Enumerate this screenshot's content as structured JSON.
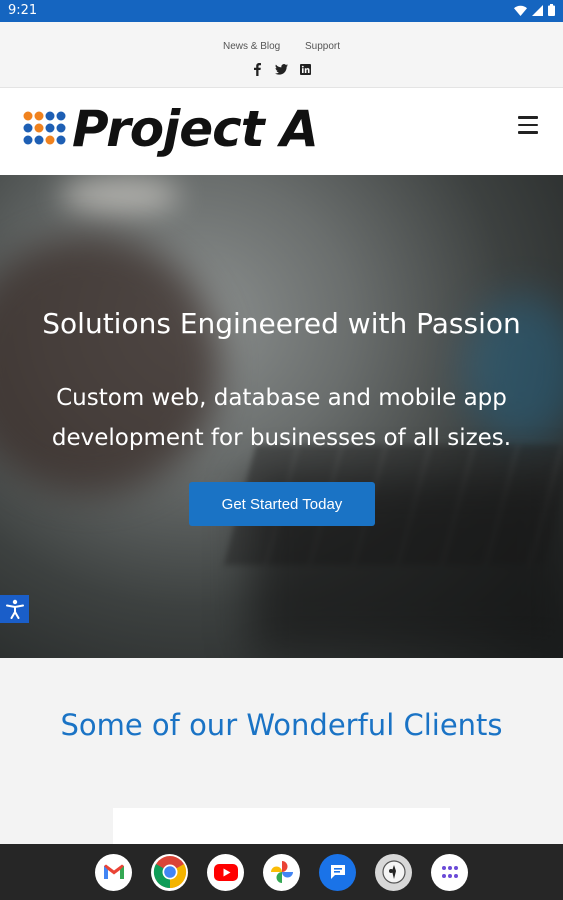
{
  "status": {
    "time": "9:21"
  },
  "topbar": {
    "links": [
      "News & Blog",
      "Support"
    ],
    "social": [
      "facebook-icon",
      "twitter-icon",
      "linkedin-icon"
    ]
  },
  "header": {
    "logo_text": "Project A"
  },
  "hero": {
    "headline": "Solutions Engineered with Passion",
    "subhead": "Custom web, database and mobile app development for businesses of all sizes.",
    "cta": "Get Started Today"
  },
  "clients": {
    "title": "Some of our Wonderful Clients"
  },
  "taskbar": {
    "apps": [
      "gmail-icon",
      "chrome-icon",
      "youtube-icon",
      "photos-icon",
      "messages-icon",
      "app-icon",
      "app-drawer-icon"
    ]
  },
  "colors": {
    "accent": "#1a73c5",
    "statusbar": "#1565c0",
    "logo_orange": "#f0821e",
    "logo_blue": "#1e5fb4"
  }
}
